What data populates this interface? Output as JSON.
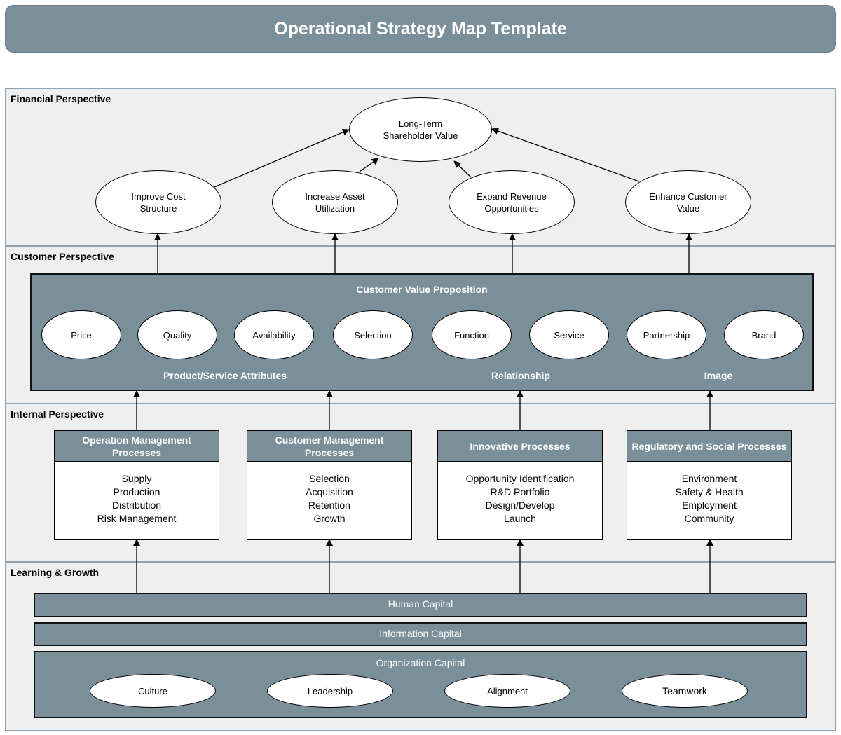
{
  "title": "Operational Strategy Map Template",
  "perspectives": {
    "financial": "Financial Perspective",
    "customer": "Customer Perspective",
    "internal": "Internal Perspective",
    "learning": "Learning & Growth"
  },
  "financial": {
    "top": "Long-Term Shareholder Value",
    "top_lines": [
      "Long-Term",
      "Shareholder Value"
    ],
    "objectives": [
      {
        "line1": "Improve Cost",
        "line2": "Structure"
      },
      {
        "line1": "Increase Asset",
        "line2": "Utilization"
      },
      {
        "line1": "Expand Revenue",
        "line2": "Opportunities"
      },
      {
        "line1": "Enhance Customer",
        "line2": "Value"
      }
    ]
  },
  "customer": {
    "heading": "Customer Value Proposition",
    "attributes": [
      "Price",
      "Quality",
      "Availability",
      "Selection",
      "Function",
      "Service",
      "Partnership",
      "Brand"
    ],
    "groups": [
      "Product/Service Attributes",
      "Relationship",
      "Image"
    ]
  },
  "internal": {
    "processes": [
      {
        "title": "Operation Management Processes",
        "items": [
          "Supply",
          "Production",
          "Distribution",
          "Risk Management"
        ]
      },
      {
        "title": "Customer Management Processes",
        "items": [
          "Selection",
          "Acquisition",
          "Retention",
          "Growth"
        ]
      },
      {
        "title": "Innovative Processes",
        "items": [
          "Opportunity Identification",
          "R&D Portfolio",
          "Design/Develop",
          "Launch"
        ]
      },
      {
        "title": "Regulatory and Social Processes",
        "items": [
          "Environment",
          "Safety & Health",
          "Employment",
          "Community"
        ]
      }
    ]
  },
  "learning": {
    "human": "Human Capital",
    "information": "Information Capital",
    "organization": "Organization Capital",
    "org_items": [
      "Culture",
      "Leadership",
      "Alignment",
      "Teamwork"
    ]
  },
  "colors": {
    "slate": "#7a8f9a",
    "band_bg": "#efefef",
    "band_border": "#8fa4b0"
  }
}
